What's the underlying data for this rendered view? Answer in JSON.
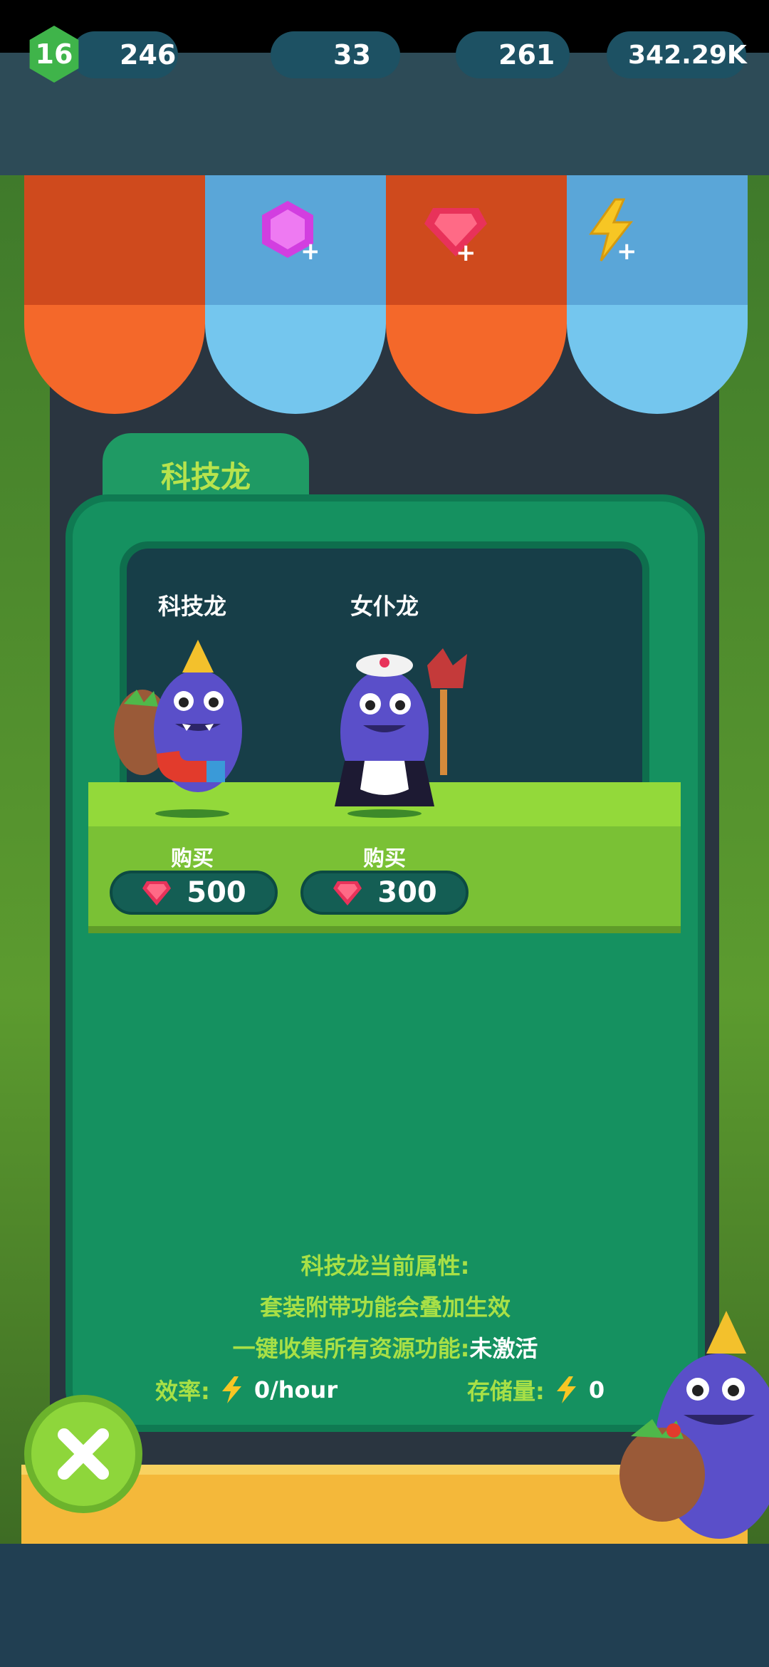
{
  "resources": {
    "level": "16",
    "xp": "246",
    "purple_gems": "33",
    "red_gems": "261",
    "energy": "342.29K"
  },
  "panel": {
    "title": "科技龙"
  },
  "items": [
    {
      "name": "科技龙",
      "buy_label": "购买",
      "price": "500"
    },
    {
      "name": "女仆龙",
      "buy_label": "购买",
      "price": "300"
    }
  ],
  "info": {
    "line1": "科技龙当前属性:",
    "line2": "套装附带功能会叠加生效",
    "line3_label": "一键收集所有资源功能:",
    "line3_value": "未激活",
    "efficiency_label": "效率:",
    "efficiency_value": "0/hour",
    "storage_label": "存储量:",
    "storage_value": "0"
  },
  "icons": {
    "level": "level-hexagon-icon",
    "purple_gem": "purple-gem-icon",
    "red_gem": "red-gem-icon",
    "energy": "lightning-bolt-icon",
    "close": "close-x-icon"
  },
  "colors": {
    "panel_green": "#159160",
    "accent_lime": "#a8e046",
    "awning_orange": "#f4682a",
    "awning_blue": "#74c6ee"
  }
}
